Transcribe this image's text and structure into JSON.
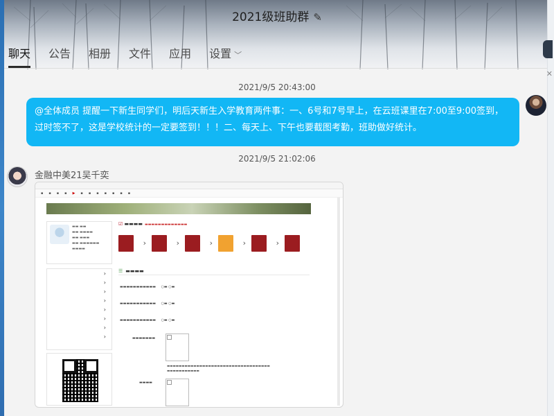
{
  "window": {
    "title": "2021级班助群",
    "edit_icon": "pencil-icon"
  },
  "tabs": [
    {
      "label": "聊天",
      "active": true
    },
    {
      "label": "公告",
      "active": false
    },
    {
      "label": "相册",
      "active": false
    },
    {
      "label": "文件",
      "active": false
    },
    {
      "label": "应用",
      "active": false
    },
    {
      "label": "设置",
      "active": false
    }
  ],
  "messages": [
    {
      "timestamp": "2021/9/5 20:43:00",
      "direction": "outgoing",
      "text": "@全体成员 提醒一下新生同学们，明后天新生入学教育两件事：一、6号和7号早上，在云班课里在7:00至9:00签到，过时签不了，这是学校统计的一定要签到！！！二、每天上、下午也要截图考勤，班助做好统计。"
    },
    {
      "timestamp": "2021/9/5 21:02:06",
      "direction": "incoming",
      "sender": "金融中美21吴千奕",
      "type": "image"
    }
  ],
  "colors": {
    "bubble_out": "#12b7f5",
    "accent_red": "#9b1c20",
    "accent_orange": "#f1a230"
  }
}
